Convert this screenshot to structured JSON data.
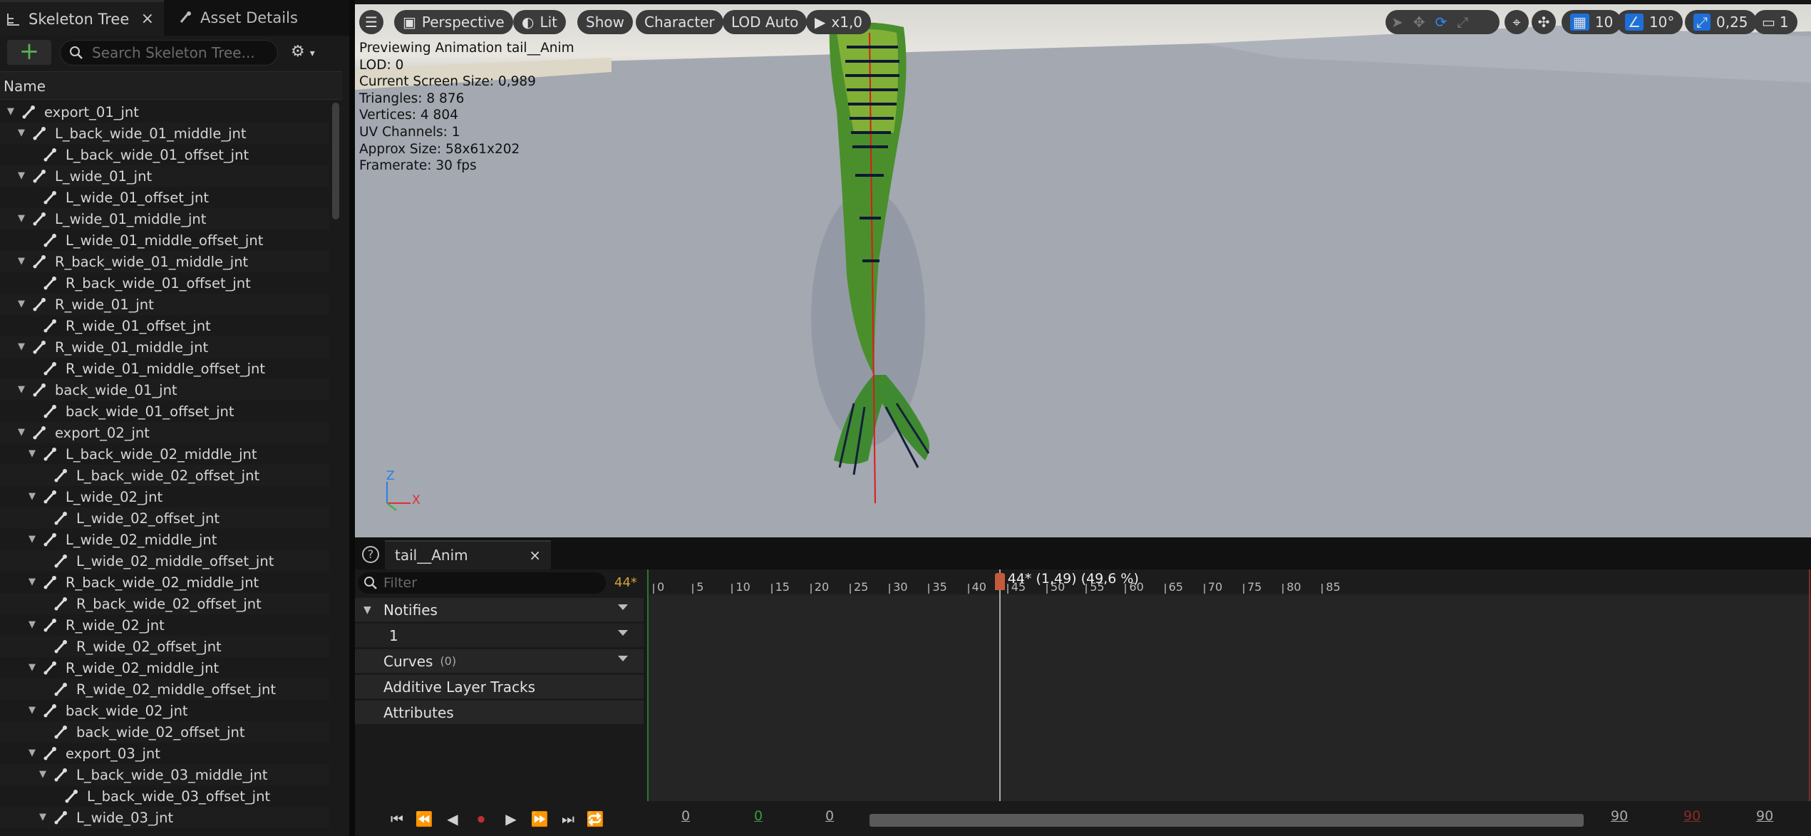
{
  "left_panel": {
    "tabs": [
      {
        "label": "Skeleton Tree"
      },
      {
        "label": "Asset Details"
      }
    ],
    "add_label": "+",
    "search_placeholder": "Search Skeleton Tree...",
    "column_header": "Name",
    "tree": [
      {
        "label": "export_01_jnt",
        "depth": 0,
        "expand": true
      },
      {
        "label": "L_back_wide_01_middle_jnt",
        "depth": 1,
        "expand": true
      },
      {
        "label": "L_back_wide_01_offset_jnt",
        "depth": 2,
        "expand": false
      },
      {
        "label": "L_wide_01_jnt",
        "depth": 1,
        "expand": true
      },
      {
        "label": "L_wide_01_offset_jnt",
        "depth": 2,
        "expand": false
      },
      {
        "label": "L_wide_01_middle_jnt",
        "depth": 1,
        "expand": true
      },
      {
        "label": "L_wide_01_middle_offset_jnt",
        "depth": 2,
        "expand": false
      },
      {
        "label": "R_back_wide_01_middle_jnt",
        "depth": 1,
        "expand": true
      },
      {
        "label": "R_back_wide_01_offset_jnt",
        "depth": 2,
        "expand": false
      },
      {
        "label": "R_wide_01_jnt",
        "depth": 1,
        "expand": true
      },
      {
        "label": "R_wide_01_offset_jnt",
        "depth": 2,
        "expand": false
      },
      {
        "label": "R_wide_01_middle_jnt",
        "depth": 1,
        "expand": true
      },
      {
        "label": "R_wide_01_middle_offset_jnt",
        "depth": 2,
        "expand": false
      },
      {
        "label": "back_wide_01_jnt",
        "depth": 1,
        "expand": true
      },
      {
        "label": "back_wide_01_offset_jnt",
        "depth": 2,
        "expand": false
      },
      {
        "label": "export_02_jnt",
        "depth": 1,
        "expand": true
      },
      {
        "label": "L_back_wide_02_middle_jnt",
        "depth": 2,
        "expand": true
      },
      {
        "label": "L_back_wide_02_offset_jnt",
        "depth": 3,
        "expand": false
      },
      {
        "label": "L_wide_02_jnt",
        "depth": 2,
        "expand": true
      },
      {
        "label": "L_wide_02_offset_jnt",
        "depth": 3,
        "expand": false
      },
      {
        "label": "L_wide_02_middle_jnt",
        "depth": 2,
        "expand": true
      },
      {
        "label": "L_wide_02_middle_offset_jnt",
        "depth": 3,
        "expand": false
      },
      {
        "label": "R_back_wide_02_middle_jnt",
        "depth": 2,
        "expand": true
      },
      {
        "label": "R_back_wide_02_offset_jnt",
        "depth": 3,
        "expand": false
      },
      {
        "label": "R_wide_02_jnt",
        "depth": 2,
        "expand": true
      },
      {
        "label": "R_wide_02_offset_jnt",
        "depth": 3,
        "expand": false
      },
      {
        "label": "R_wide_02_middle_jnt",
        "depth": 2,
        "expand": true
      },
      {
        "label": "R_wide_02_middle_offset_jnt",
        "depth": 3,
        "expand": false
      },
      {
        "label": "back_wide_02_jnt",
        "depth": 2,
        "expand": true
      },
      {
        "label": "back_wide_02_offset_jnt",
        "depth": 3,
        "expand": false
      },
      {
        "label": "export_03_jnt",
        "depth": 2,
        "expand": true
      },
      {
        "label": "L_back_wide_03_middle_jnt",
        "depth": 3,
        "expand": true
      },
      {
        "label": "L_back_wide_03_offset_jnt",
        "depth": 4,
        "expand": false
      },
      {
        "label": "L_wide_03_jnt",
        "depth": 3,
        "expand": true
      }
    ]
  },
  "viewport": {
    "toolbar": {
      "perspective": "Perspective",
      "lit": "Lit",
      "show": "Show",
      "character": "Character",
      "lod": "LOD Auto",
      "speed": "x1,0",
      "grid_size": "10",
      "rotation_snap": "10°",
      "scale_snap": "0,25",
      "camera_speed": "1"
    },
    "stats": [
      "Previewing Animation tail__Anim",
      "LOD: 0",
      "Current Screen Size: 0,989",
      "Triangles: 8 876",
      "Vertices: 4 804",
      "UV Channels: 1",
      "Approx Size: 58x61x202",
      "Framerate: 30 fps"
    ],
    "axis_labels": {
      "z": "Z",
      "x": "X"
    }
  },
  "sequencer": {
    "tab_label": "tail__Anim",
    "filter_placeholder": "Filter",
    "current_frame": "44*",
    "tracks": {
      "notifies": "Notifies",
      "notify_track": "1",
      "curves": "Curves",
      "curves_count": "(0)",
      "additive": "Additive Layer Tracks",
      "attributes": "Attributes"
    },
    "ruler_ticks": [
      "0",
      "5",
      "10",
      "15",
      "20",
      "25",
      "30",
      "35",
      "40",
      "45",
      "50",
      "55",
      "60",
      "65",
      "70",
      "75",
      "80",
      "85"
    ],
    "playhead_label": "44* (1,49) (49,6 %)",
    "playhead_frame": 44,
    "range": {
      "view_start": "0",
      "working_start": "0",
      "play_start": "0",
      "play_end": "90",
      "working_end": "90",
      "view_end": "90"
    }
  },
  "colors": {
    "accent_orange": "#d4a13a",
    "add_green": "#58b04c",
    "playhead_red": "#c35a3b",
    "active_blue": "#1e6fd9"
  }
}
